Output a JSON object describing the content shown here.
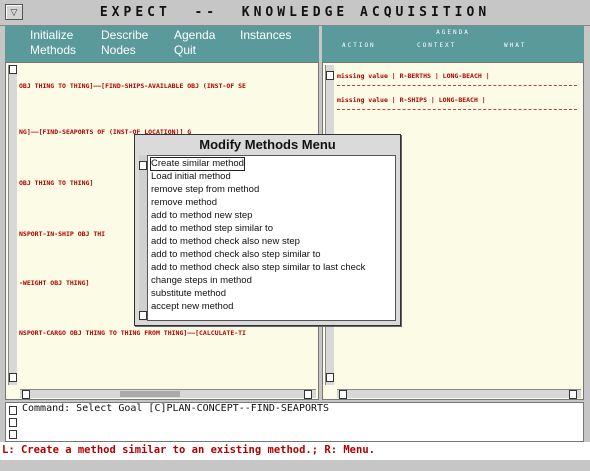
{
  "window": {
    "title": "EXPECT  --  KNOWLEDGE ACQUISITION",
    "menu_button_glyph": "▽"
  },
  "menubar": {
    "items": [
      {
        "label": "Initialize"
      },
      {
        "label": "Methods"
      },
      {
        "label": "Describe"
      },
      {
        "label": "Nodes"
      },
      {
        "label": "Agenda"
      },
      {
        "label": "Quit"
      },
      {
        "label": "Instances"
      }
    ]
  },
  "agenda": {
    "title": "AGENDA",
    "columns": [
      "ACTION",
      "CONTEXT",
      "WHAT"
    ],
    "rows": [
      {
        "text": "missing value  | R-BERTHS    | LONG-BEACH   |"
      },
      {
        "text": "missing value  | R-SHIPS     | LONG-BEACH   |"
      }
    ]
  },
  "method_tree": {
    "lines": [
      {
        "text": "OBJ THING TO THING]——[FIND-SHIPS-AVAILABLE OBJ (INST-OF SE"
      },
      {
        "text": "NG]——[FIND-SEAPORTS OF (INST-OF LOCATION)] G"
      },
      {
        "text": "OBJ THING TO THING]"
      },
      {
        "text": "NSPORT-IN-SHIP OBJ THI"
      },
      {
        "text": "-WEIGHT OBJ THING]"
      },
      {
        "text": "NSPORT-CARGO OBJ THING TO THING FROM THING]——[CALCULATE-TI"
      }
    ]
  },
  "command": {
    "text": "Command: Select Goal [C]PLAN-CONCEPT--FIND-SEAPORTS"
  },
  "status": {
    "text": "L: Create a method similar to an existing method.; R: Menu."
  },
  "modal": {
    "title": "Modify Methods Menu",
    "items": [
      {
        "label": "Create similar method"
      },
      {
        "label": "Load initial method"
      },
      {
        "label": "remove step from method"
      },
      {
        "label": "remove method"
      },
      {
        "label": "add to method new step"
      },
      {
        "label": "add to method step similar to"
      },
      {
        "label": "add to method check also new step"
      },
      {
        "label": "add to method check also step similar to"
      },
      {
        "label": "add to method check also step similar to last check"
      },
      {
        "label": "change steps in method"
      },
      {
        "label": "substitute method"
      },
      {
        "label": "accept new method"
      }
    ]
  },
  "colors": {
    "menubar_bg": "#5a9a9a",
    "pane_bg": "#fcfbe6",
    "tree_text": "#b00000"
  }
}
